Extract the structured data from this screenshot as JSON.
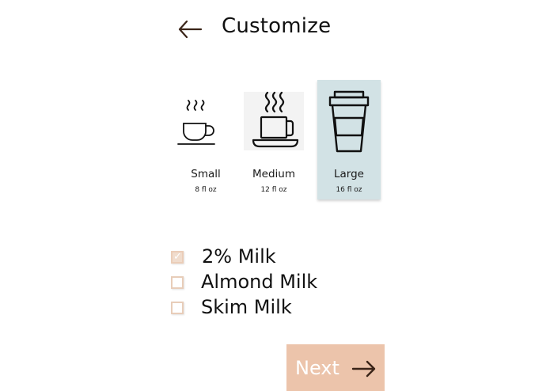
{
  "header": {
    "title": "Customize",
    "back_icon": "arrow-left-icon"
  },
  "sizes": [
    {
      "label": "Small",
      "volume": "8 fl oz",
      "icon": "small-cup-icon",
      "selected": false
    },
    {
      "label": "Medium",
      "volume": "12 fl oz",
      "icon": "medium-mug-icon",
      "selected": false
    },
    {
      "label": "Large",
      "volume": "16 fl oz",
      "icon": "large-togo-cup-icon",
      "selected": true
    }
  ],
  "milk_options": [
    {
      "label": "2% Milk",
      "checked": true
    },
    {
      "label": "Almond Milk",
      "checked": false
    },
    {
      "label": "Skim Milk",
      "checked": false
    }
  ],
  "next_button": {
    "label": "Next",
    "icon": "arrow-right-icon"
  },
  "colors": {
    "accent": "#ecc4ab",
    "selected_bg": "#d2e2e5",
    "checkbox_border": "#e8cdb9",
    "back_arrow": "#3a2418"
  }
}
